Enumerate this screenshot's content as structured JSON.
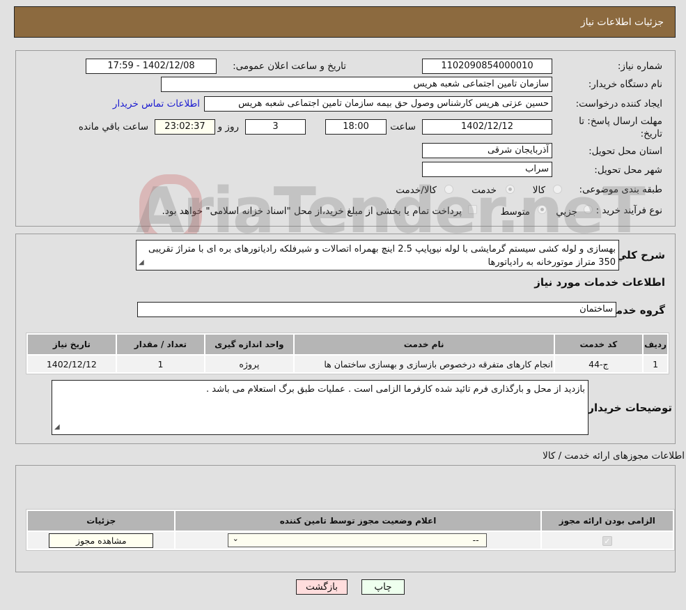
{
  "header": {
    "title": "جزئیات اطلاعات نیاز"
  },
  "form": {
    "need_number_label": "شماره نیاز:",
    "need_number": "1102090854000010",
    "announce_label": "تاریخ و ساعت اعلان عمومی:",
    "announce_value": "1402/12/08 - 17:59",
    "buyer_org_label": "نام دستگاه خریدار:",
    "buyer_org": "سازمان تامین اجتماعی شعبه هریس",
    "creator_label": "ایجاد کننده درخواست:",
    "creator": "حسین  عزتی هریس  کارشناس وصول حق بیمه  سازمان تامین اجتماعی شعبه هریس",
    "contact_link": "اطلاعات تماس خریدار",
    "deadline_label": "مهلت ارسال پاسخ: تا تاریخ:",
    "deadline_date": "1402/12/12",
    "time_label": "ساعت",
    "deadline_time": "18:00",
    "days_value": "3",
    "days_label": "روز و",
    "remaining_time": "23:02:37",
    "remaining_label": "ساعت باقي مانده",
    "province_label": "استان محل تحویل:",
    "province": "آذربایجان شرقی",
    "city_label": "شهر محل تحویل:",
    "city": "سراب",
    "category_label": "طبقه بندی موضوعی:",
    "category_options": [
      {
        "label": "کالا",
        "selected": false
      },
      {
        "label": "خدمت",
        "selected": true
      },
      {
        "label": "کالا/خدمت",
        "selected": false
      }
    ],
    "purchase_type_label": "نوع فرآیند خرید :",
    "purchase_options": [
      {
        "label": "جزیي",
        "selected": false
      },
      {
        "label": "متوسط",
        "selected": true
      }
    ],
    "treasury_note": "پرداخت تمام یا بخشی از مبلغ خرید،از محل \"اسناد خزانه اسلامی\" خواهد بود."
  },
  "description": {
    "label": "شرح کلي نیاز:",
    "text": "بهسازی و لوله کشی سیستم گرمایشی با لوله نیوپایپ 2.5 اینچ بهمراه اتصالات و شیرفلکه رادیاتورهای بره ای با متراژ تقریبی 350 متراز موتورخانه به رادیاتورها"
  },
  "services": {
    "section_title": "اطلاعات خدمات مورد نیاز",
    "group_label": "گروه خدمت:",
    "group_value": "ساختمان",
    "columns": [
      "ردیف",
      "کد خدمت",
      "نام خدمت",
      "واحد اندازه گیری",
      "تعداد / مقدار",
      "تاریخ نیاز"
    ],
    "rows": [
      {
        "index": "1",
        "code": "ج-44",
        "name": "انجام کارهای متفرقه درخصوص بازسازی و بهسازی ساختمان ها",
        "unit": "پروژه",
        "qty": "1",
        "date": "1402/12/12"
      }
    ]
  },
  "buyer_notes": {
    "label": "توضیحات خریدار:",
    "text": "بازدید از محل و بارگذاری فرم تائید شده کارفرما الزامی است . عملیات طبق برگ استعلام می باشد ."
  },
  "permits": {
    "section_title": "اطلاعات مجوزهای ارائه خدمت / کالا",
    "columns": [
      "الزامی بودن ارائه مجوز",
      "اعلام وضعیت مجوز توسط تامین کننده",
      "جزئیات"
    ],
    "rows": [
      {
        "required": true,
        "status_value": "--",
        "details_button": "مشاهده مجوز"
      }
    ]
  },
  "footer": {
    "print_button": "چاپ",
    "back_button": "بازگشت"
  },
  "watermark": "AriaTender.neT",
  "colors": {
    "header_bg": "#8c6a3f",
    "back_button_bg": "#ffdddd",
    "print_button_bg": "#eeffee",
    "link": "#1b1bd0"
  }
}
